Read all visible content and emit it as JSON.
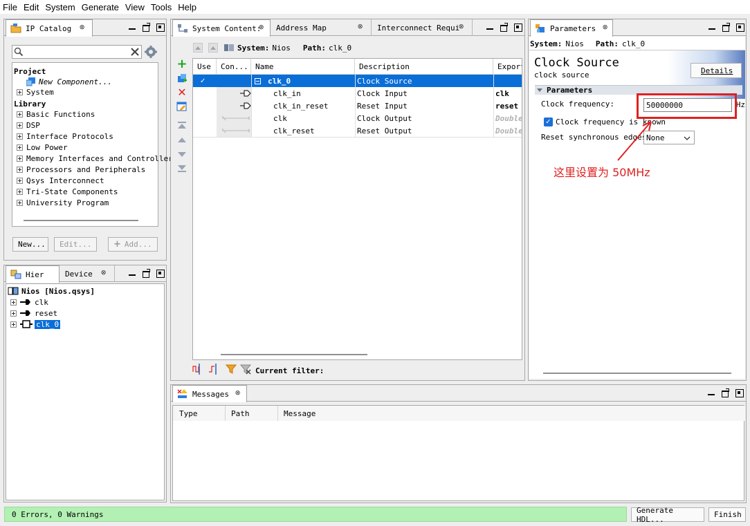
{
  "menu": [
    "File",
    "Edit",
    "System",
    "Generate",
    "View",
    "Tools",
    "Help"
  ],
  "ip_catalog": {
    "tab_label": "IP Catalog",
    "search_placeholder": "",
    "tree": {
      "project_label": "Project",
      "new_component": "New Component...",
      "system": "System",
      "library_label": "Library",
      "library_items": [
        "Basic Functions",
        "DSP",
        "Interface Protocols",
        "Low Power",
        "Memory Interfaces and Controller",
        "Processors and Peripherals",
        "Qsys Interconnect",
        "Tri-State Components",
        "University Program"
      ]
    },
    "buttons": {
      "new": "New...",
      "edit": "Edit...",
      "add": "Add..."
    }
  },
  "hierarchy": {
    "tabs": [
      "Hier",
      "Device"
    ],
    "root": "Nios [Nios.qsys]",
    "items": [
      "clk",
      "reset",
      "clk_0"
    ]
  },
  "system_contents": {
    "tabs": [
      "System Content:",
      "Address Map",
      "Interconnect Requi"
    ],
    "system_label": "System:",
    "system_value": "Nios",
    "path_label": "Path:",
    "path_value": "clk_0",
    "columns": [
      "Use",
      "Con...",
      "Name",
      "Description",
      "Export"
    ],
    "rows": [
      {
        "name": "clk_0",
        "description": "Clock Source",
        "export": "",
        "selected": true
      },
      {
        "name": "clk_in",
        "description": "Clock Input",
        "export": "clk",
        "selected": false
      },
      {
        "name": "clk_in_reset",
        "description": "Reset Input",
        "export": "reset",
        "selected": false
      },
      {
        "name": "clk",
        "description": "Clock Output",
        "export": "Double",
        "selected": false
      },
      {
        "name": "clk_reset",
        "description": "Reset Output",
        "export": "Double",
        "selected": false
      }
    ],
    "filter_label": "Current filter:"
  },
  "parameters": {
    "tab_label": "Parameters",
    "system_label": "System:",
    "system_value": "Nios",
    "path_label": "Path:",
    "path_value": "clk_0",
    "component_title": "Clock Source",
    "component_subtitle": "clock source",
    "details_button": "Details",
    "section_label": "Parameters",
    "clock_frequency_label": "Clock frequency:",
    "clock_frequency_value": "50000000",
    "clock_frequency_unit": "Hz",
    "clock_known_label": "Clock frequency is known",
    "reset_sync_label": "Reset synchronous edges:",
    "reset_sync_value": "None"
  },
  "annotation": {
    "text": "这里设置为 50MHz",
    "color": "#e02020"
  },
  "messages": {
    "tab_label": "Messages",
    "columns": [
      "Type",
      "Path",
      "Message"
    ]
  },
  "status": {
    "text": "0 Errors, 0 Warnings",
    "generate_button": "Generate HDL...",
    "finish_button": "Finish"
  },
  "colors": {
    "selection": "#0a6ed8",
    "status_ok": "#b3f0b3",
    "accent_red": "#e02020"
  }
}
